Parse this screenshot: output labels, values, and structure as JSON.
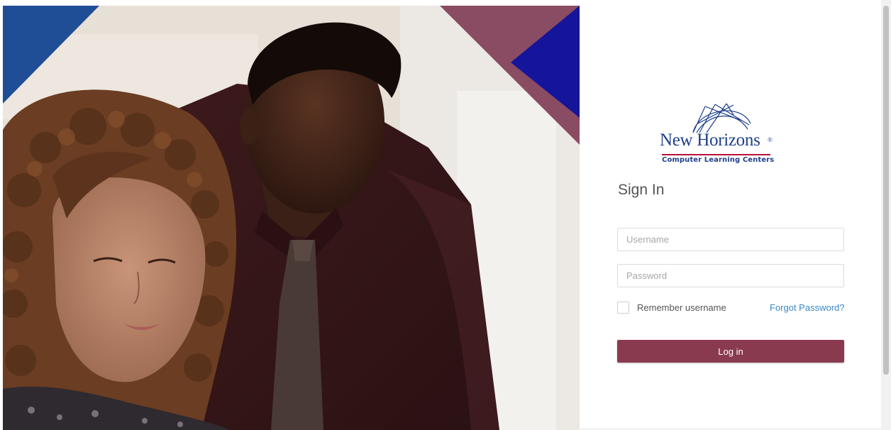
{
  "logo": {
    "brand_name": "New Horizons",
    "registered_mark": "®",
    "tagline": "Computer Learning Centers",
    "brand_color": "#1e3f8a",
    "accent_color": "#b5123b"
  },
  "form": {
    "heading": "Sign In",
    "username_placeholder": "Username",
    "password_placeholder": "Password",
    "remember_label": "Remember username",
    "remember_checked": false,
    "forgot_link": "Forgot Password?",
    "login_button": "Log in"
  },
  "colors": {
    "button": "#8a3a4f",
    "link": "#3b87c8",
    "corner_blue": "#1f4e96",
    "corner_maroon": "#8a4c62",
    "corner_indigo": "#15159b"
  },
  "hero": {
    "icon": "photo-two-people-at-computer"
  }
}
